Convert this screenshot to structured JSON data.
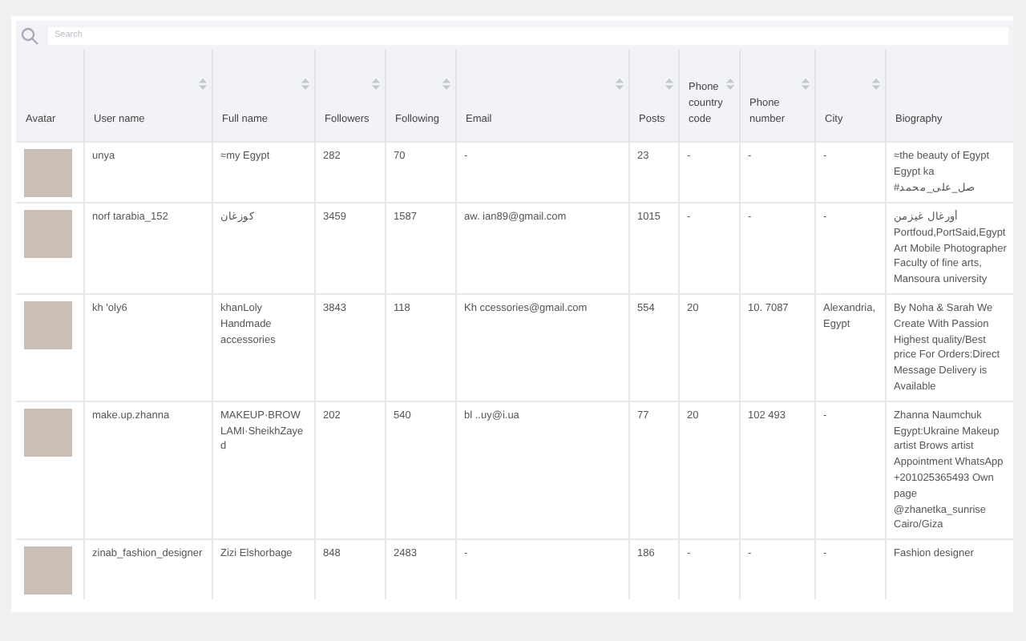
{
  "search": {
    "placeholder": "Search"
  },
  "table": {
    "columns": [
      {
        "label": "Avatar",
        "sortable": false
      },
      {
        "label": "User name",
        "sortable": true
      },
      {
        "label": "Full name",
        "sortable": true
      },
      {
        "label": "Followers",
        "sortable": true
      },
      {
        "label": "Following",
        "sortable": true
      },
      {
        "label": "Email",
        "sortable": true
      },
      {
        "label": "Posts",
        "sortable": true
      },
      {
        "label": "Phone country code",
        "sortable": true
      },
      {
        "label": "Phone number",
        "sortable": true
      },
      {
        "label": "City",
        "sortable": true
      },
      {
        "label": "Biography",
        "sortable": false
      }
    ],
    "rows": [
      {
        "cells": [
          "",
          "unya",
          "≈my Egypt",
          "282",
          "70",
          "-",
          "23",
          "-",
          "-",
          "-",
          "≈the beauty of Egypt Egypt ka #صل_على_محمد"
        ]
      },
      {
        "cells": [
          "",
          "norf tarabia_152",
          "كوزغان",
          "3459",
          "1587",
          "aw. ian89@gmail.com",
          "1015",
          "-",
          "-",
          "-",
          "أورغال غيزمن Portfoud,PortSaid,Egypt Art Mobile Photographer Faculty of fine arts, Mansoura university"
        ]
      },
      {
        "cells": [
          "",
          "kh 'oly6",
          "khanLoly Handmade accessories",
          "3843",
          "118",
          "Kh ccessories@gmail.com",
          "554",
          "20",
          "10. 7087",
          "Alexandria, Egypt",
          "By Noha & Sarah We Create With Passion Highest quality/Best price For Orders:Direct Message Delivery is Available"
        ]
      },
      {
        "cells": [
          "",
          "make.up.zhanna",
          "MAKEUP·BROW LAMI·SheikhZayed",
          "202",
          "540",
          "bl ..uy@i.ua",
          "77",
          "20",
          "102 493",
          "-",
          "Zhanna Naumchuk Egypt:Ukraine Makeup artist Brows artist Appointment WhatsApp +201025365493 Own page @zhanetka_sunrise Cairo/Giza"
        ]
      },
      {
        "cells": [
          "",
          "zinab_fashion_designer",
          "Zizi Elshorbage",
          "848",
          "2483",
          "-",
          "186",
          "-",
          "-",
          "-",
          "Fashion designer"
        ]
      }
    ]
  }
}
